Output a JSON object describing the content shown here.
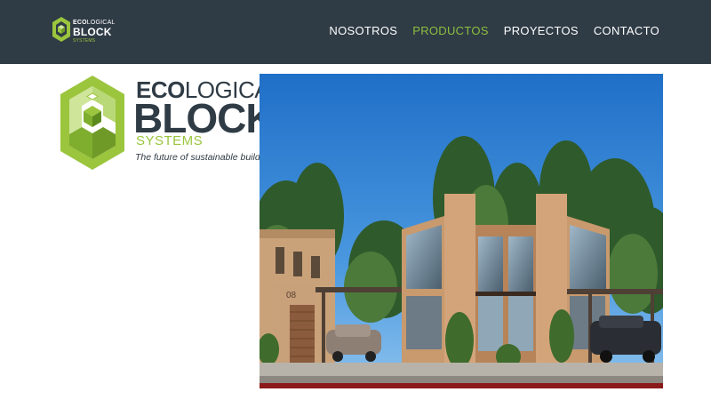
{
  "navbar": {
    "logo": {
      "eco": "ECO",
      "logical": "LOGICAL",
      "block": "BLOCK",
      "systems": "SYSTEMS"
    },
    "menu": [
      {
        "label": "NOSOTROS",
        "active": false
      },
      {
        "label": "PRODUCTOS",
        "active": true
      },
      {
        "label": "PROYECTOS",
        "active": false
      },
      {
        "label": "CONTACTO",
        "active": false
      }
    ]
  },
  "hero_logo": {
    "eco": "ECO",
    "logical": "LOGICAL",
    "block": "BLOCK",
    "systems": "SYSTEMS",
    "tagline": "The future of sustainable building"
  },
  "hero_image": {
    "house_number": "08"
  },
  "colors": {
    "navbar_bg": "#2f3b45",
    "accent_green": "#8dbf3f",
    "logo_dark": "#2f3b45"
  }
}
